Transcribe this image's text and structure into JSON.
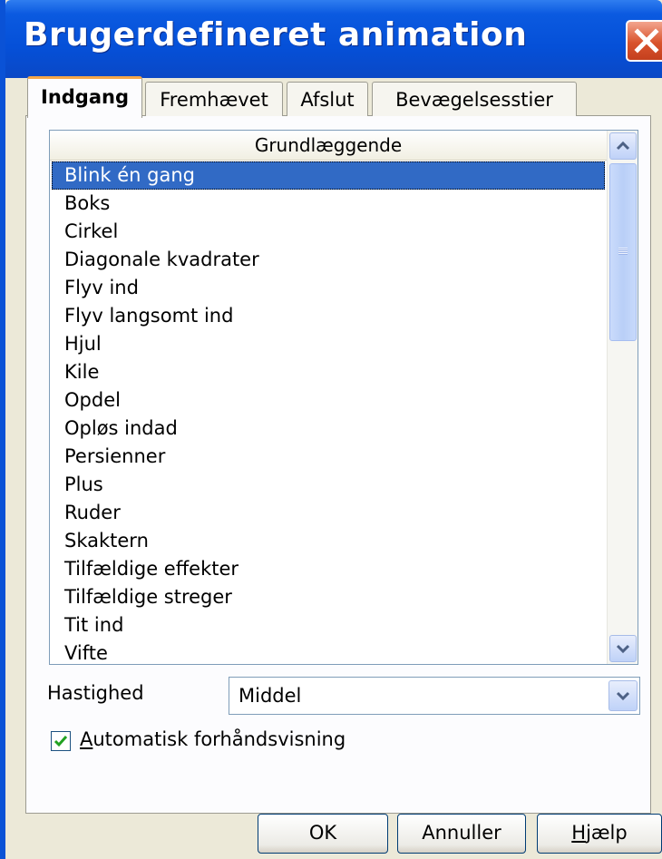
{
  "window": {
    "title": "Brugerdefineret animation"
  },
  "tabs": [
    {
      "label": "Indgang",
      "active": true
    },
    {
      "label": "Fremhævet",
      "active": false
    },
    {
      "label": "Afslut",
      "active": false
    },
    {
      "label": "Bevægelsesstier",
      "active": false
    }
  ],
  "list": {
    "header": "Grundlæggende",
    "selected_index": 0,
    "items": [
      "Blink én gang",
      "Boks",
      "Cirkel",
      "Diagonale kvadrater",
      "Flyv ind",
      "Flyv langsomt ind",
      "Hjul",
      "Kile",
      "Opdel",
      "Opløs indad",
      "Persienner",
      "Plus",
      "Ruder",
      "Skaktern",
      "Tilfældige effekter",
      "Tilfældige streger",
      "Tit ind",
      "Vifte"
    ]
  },
  "speed": {
    "label": "Hastighed",
    "value": "Middel"
  },
  "preview": {
    "checked": true,
    "access_key": "A",
    "label_rest": "utomatisk forhåndsvisning"
  },
  "buttons": {
    "ok": "OK",
    "cancel": "Annuller",
    "help_key": "H",
    "help_rest": "jælp"
  },
  "colors": {
    "titlebar": "#0550d8",
    "selection": "#316ac5",
    "tab_highlight": "#f4a74a",
    "close": "#d9532c"
  }
}
